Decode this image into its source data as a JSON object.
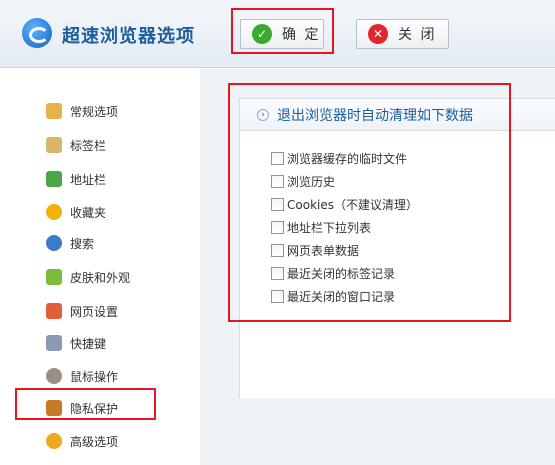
{
  "header": {
    "title": "超速浏览器选项",
    "ok_label": "确 定",
    "close_label": "关 闭"
  },
  "sidebar": {
    "items": [
      {
        "label": "常规选项",
        "icon": "house-icon",
        "color": "#e6b24a"
      },
      {
        "label": "标签栏",
        "icon": "tab-icon",
        "color": "#d9b56b"
      },
      {
        "label": "地址栏",
        "icon": "address-icon",
        "color": "#4aa745"
      },
      {
        "label": "收藏夹",
        "icon": "star-icon",
        "color": "#f2b300"
      },
      {
        "label": "搜索",
        "icon": "search-icon",
        "color": "#3b7bc8"
      },
      {
        "label": "皮肤和外观",
        "icon": "shirt-icon",
        "color": "#7cbd3b"
      },
      {
        "label": "网页设置",
        "icon": "webpage-icon",
        "color": "#e35d3a"
      },
      {
        "label": "快捷键",
        "icon": "keyboard-icon",
        "color": "#8a9ab0"
      },
      {
        "label": "鼠标操作",
        "icon": "mouse-icon",
        "color": "#9a8f80"
      },
      {
        "label": "隐私保护",
        "icon": "tools-icon",
        "color": "#c87a2a"
      },
      {
        "label": "高级选项",
        "icon": "gear-icon",
        "color": "#f0a820"
      }
    ]
  },
  "panel": {
    "title": "退出浏览器时自动清理如下数据",
    "options": [
      "浏览器缓存的临时文件",
      "浏览历史",
      "Cookies（不建议清理）",
      "地址栏下拉列表",
      "网页表单数据",
      "最近关闭的标签记录",
      "最近关闭的窗口记录"
    ]
  }
}
